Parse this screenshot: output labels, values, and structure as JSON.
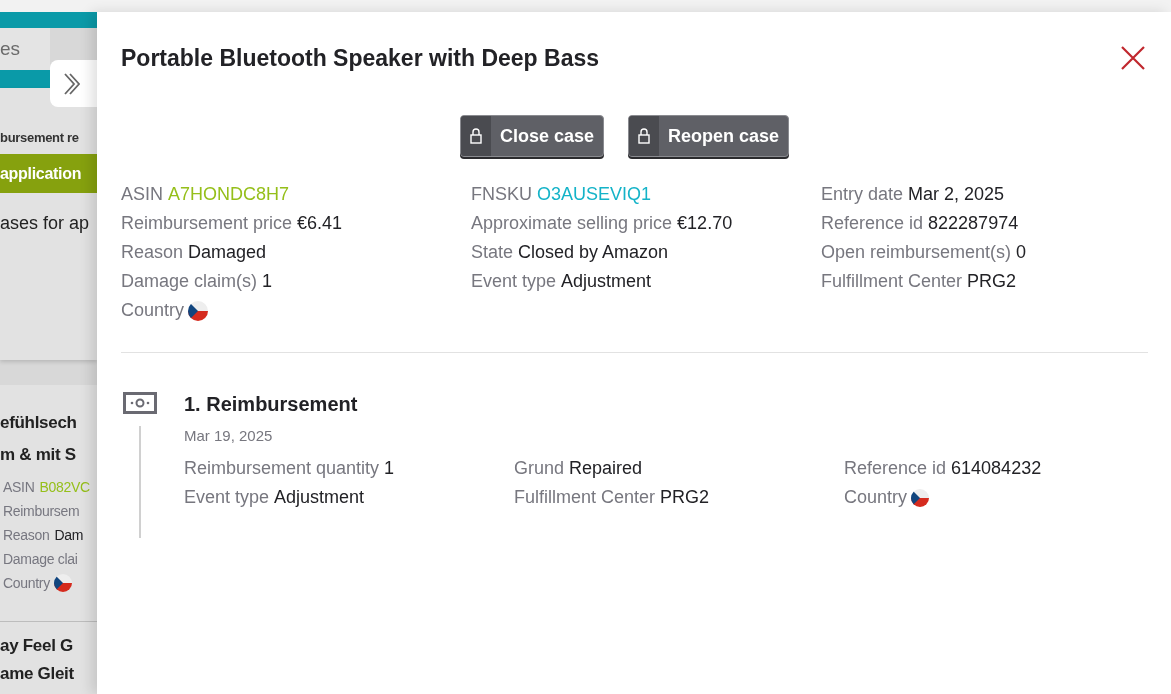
{
  "background": {
    "search_text": "es",
    "heading": "bursement re",
    "green_button": "application",
    "note": "ases for ap",
    "card": {
      "title_lines": [
        "efühlsech",
        "m & mit S"
      ],
      "fields": [
        {
          "label": "ASIN",
          "value": "B082VC",
          "kind": "asin"
        },
        {
          "label": "Reimbursem",
          "kind": "text"
        },
        {
          "label": "Reason",
          "value": "Dam",
          "kind": "text"
        },
        {
          "label": "Damage clai",
          "kind": "text"
        },
        {
          "label": "Country",
          "kind": "flag"
        }
      ]
    },
    "next_title_lines": [
      "ay Feel G",
      "ame Gleit"
    ]
  },
  "drawer": {
    "title": "Portable Bluetooth Speaker with Deep Bass",
    "buttons": [
      {
        "label": "Close case"
      },
      {
        "label": "Reopen case"
      }
    ],
    "columns": [
      [
        {
          "label": "ASIN",
          "value": "A7HONDC8H7",
          "kind": "asin"
        },
        {
          "label": "Reimbursement price",
          "value": "€6.41",
          "kind": "text"
        },
        {
          "label": "Reason",
          "value": "Damaged",
          "kind": "text"
        },
        {
          "label": "Damage claim(s)",
          "value": "1",
          "kind": "text"
        },
        {
          "label": "Country",
          "kind": "flag"
        }
      ],
      [
        {
          "label": "FNSKU",
          "value": "O3AUSEVIQ1",
          "kind": "fnsku"
        },
        {
          "label": "Approximate selling price",
          "value": "€12.70",
          "kind": "text"
        },
        {
          "label": "State",
          "value": "Closed by Amazon",
          "kind": "text"
        },
        {
          "label": "Event type",
          "value": "Adjustment",
          "kind": "text"
        }
      ],
      [
        {
          "label": "Entry date",
          "value": "Mar 2, 2025",
          "kind": "text"
        },
        {
          "label": "Reference id",
          "value": "822287974",
          "kind": "text"
        },
        {
          "label": "Open reimbursement(s)",
          "value": "0",
          "kind": "text"
        },
        {
          "label": "Fulfillment Center",
          "value": "PRG2",
          "kind": "text"
        }
      ]
    ],
    "events": [
      {
        "title": "1. Reimbursement",
        "date": "Mar 19, 2025",
        "columns": [
          [
            {
              "label": "Reimbursement quantity",
              "value": "1",
              "kind": "text"
            },
            {
              "label": "Event type",
              "value": "Adjustment",
              "kind": "text"
            }
          ],
          [
            {
              "label": "Grund",
              "value": "Repaired",
              "kind": "text"
            },
            {
              "label": "Fulfillment Center",
              "value": "PRG2",
              "kind": "text"
            }
          ],
          [
            {
              "label": "Reference id",
              "value": "614084232",
              "kind": "text"
            },
            {
              "label": "Country",
              "kind": "flag"
            }
          ]
        ]
      }
    ]
  }
}
